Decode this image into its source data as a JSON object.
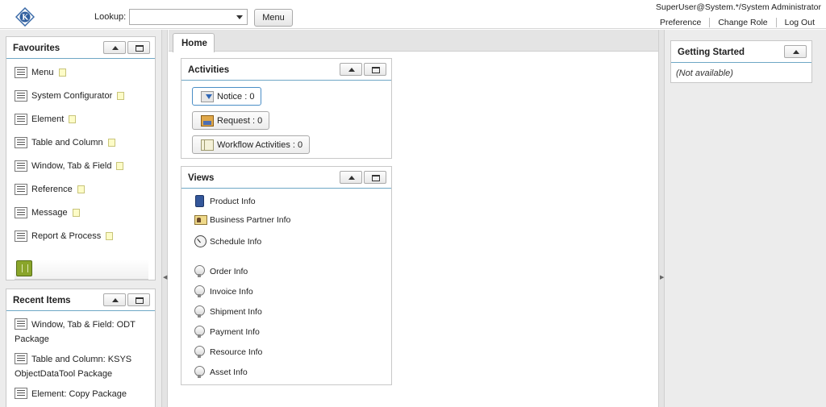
{
  "header": {
    "lookup_label": "Lookup:",
    "lookup_value": "",
    "menu_label": "Menu",
    "user_info": "SuperUser@System.*/System Administrator",
    "links": [
      "Preference",
      "Change Role",
      "Log Out"
    ]
  },
  "favourites": {
    "title": "Favourites",
    "items": [
      "Menu",
      "System Configurator",
      "Element",
      "Table and Column",
      "Window, Tab & Field",
      "Reference",
      "Message",
      "Report & Process"
    ]
  },
  "recent": {
    "title": "Recent Items",
    "items": [
      "Window, Tab & Field: ODT Package",
      "Table and Column: KSYS ObjectDataTool Package",
      "Element: Copy Package"
    ]
  },
  "tabs": {
    "home": "Home"
  },
  "activities": {
    "title": "Activities",
    "notice": "Notice : 0",
    "request": "Request : 0",
    "workflow": "Workflow Activities : 0"
  },
  "views": {
    "title": "Views",
    "items": [
      "Product Info",
      "Business Partner Info",
      "Schedule Info",
      "Order Info",
      "Invoice Info",
      "Shipment Info",
      "Payment Info",
      "Resource Info",
      "Asset Info"
    ]
  },
  "getting_started": {
    "title": "Getting Started",
    "content": "(Not available)"
  },
  "icons": {
    "logo": "k-logo-icon",
    "favourite_item": "window-icon",
    "note": "note-icon",
    "trash": "trash-icon"
  },
  "colors": {
    "header_underline": "#6ea7c5",
    "panel_bg": "#ececec"
  }
}
